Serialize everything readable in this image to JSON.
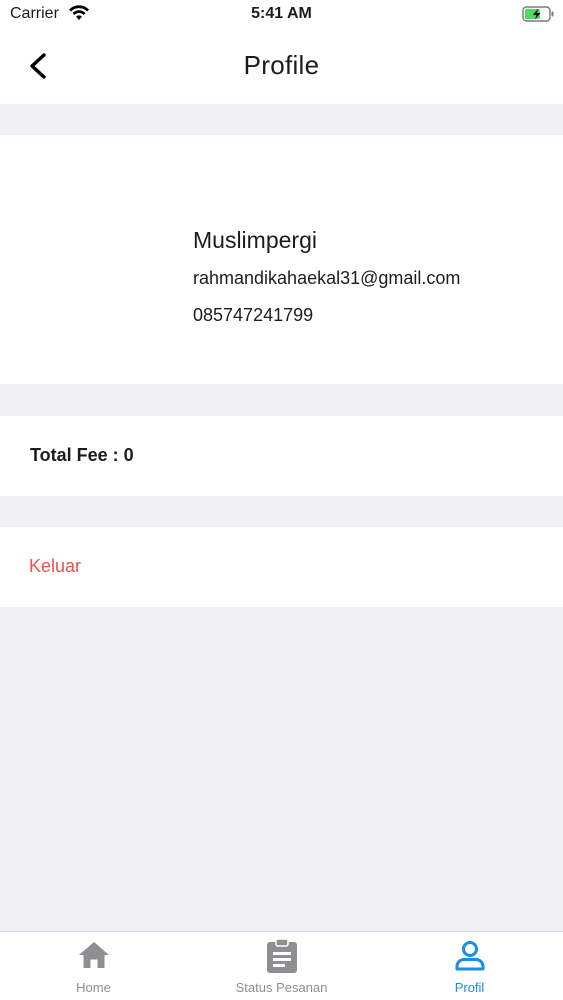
{
  "status_bar": {
    "carrier": "Carrier",
    "time": "5:41 AM",
    "icons": [
      "wifi-icon",
      "battery-charging-icon"
    ]
  },
  "header": {
    "title": "Profile",
    "back_icon": "chevron-left-icon"
  },
  "profile": {
    "name": "Muslimpergi",
    "email": "rahmandikahaekal31@gmail.com",
    "phone": "085747241799"
  },
  "fee": {
    "label": "Total Fee : 0"
  },
  "logout": {
    "label": "Keluar"
  },
  "tab_bar": {
    "active": "Profil",
    "tabs": [
      {
        "label": "Home",
        "icon": "home-icon"
      },
      {
        "label": "Status Pesanan",
        "icon": "clipboard-icon"
      },
      {
        "label": "Profil",
        "icon": "user-icon"
      }
    ]
  },
  "colors": {
    "background": "#f0eff4",
    "logout": "#e5534b",
    "active_tab": "#1a8fe3",
    "inactive_tab": "#8e8e93",
    "battery": "#4cd964"
  }
}
